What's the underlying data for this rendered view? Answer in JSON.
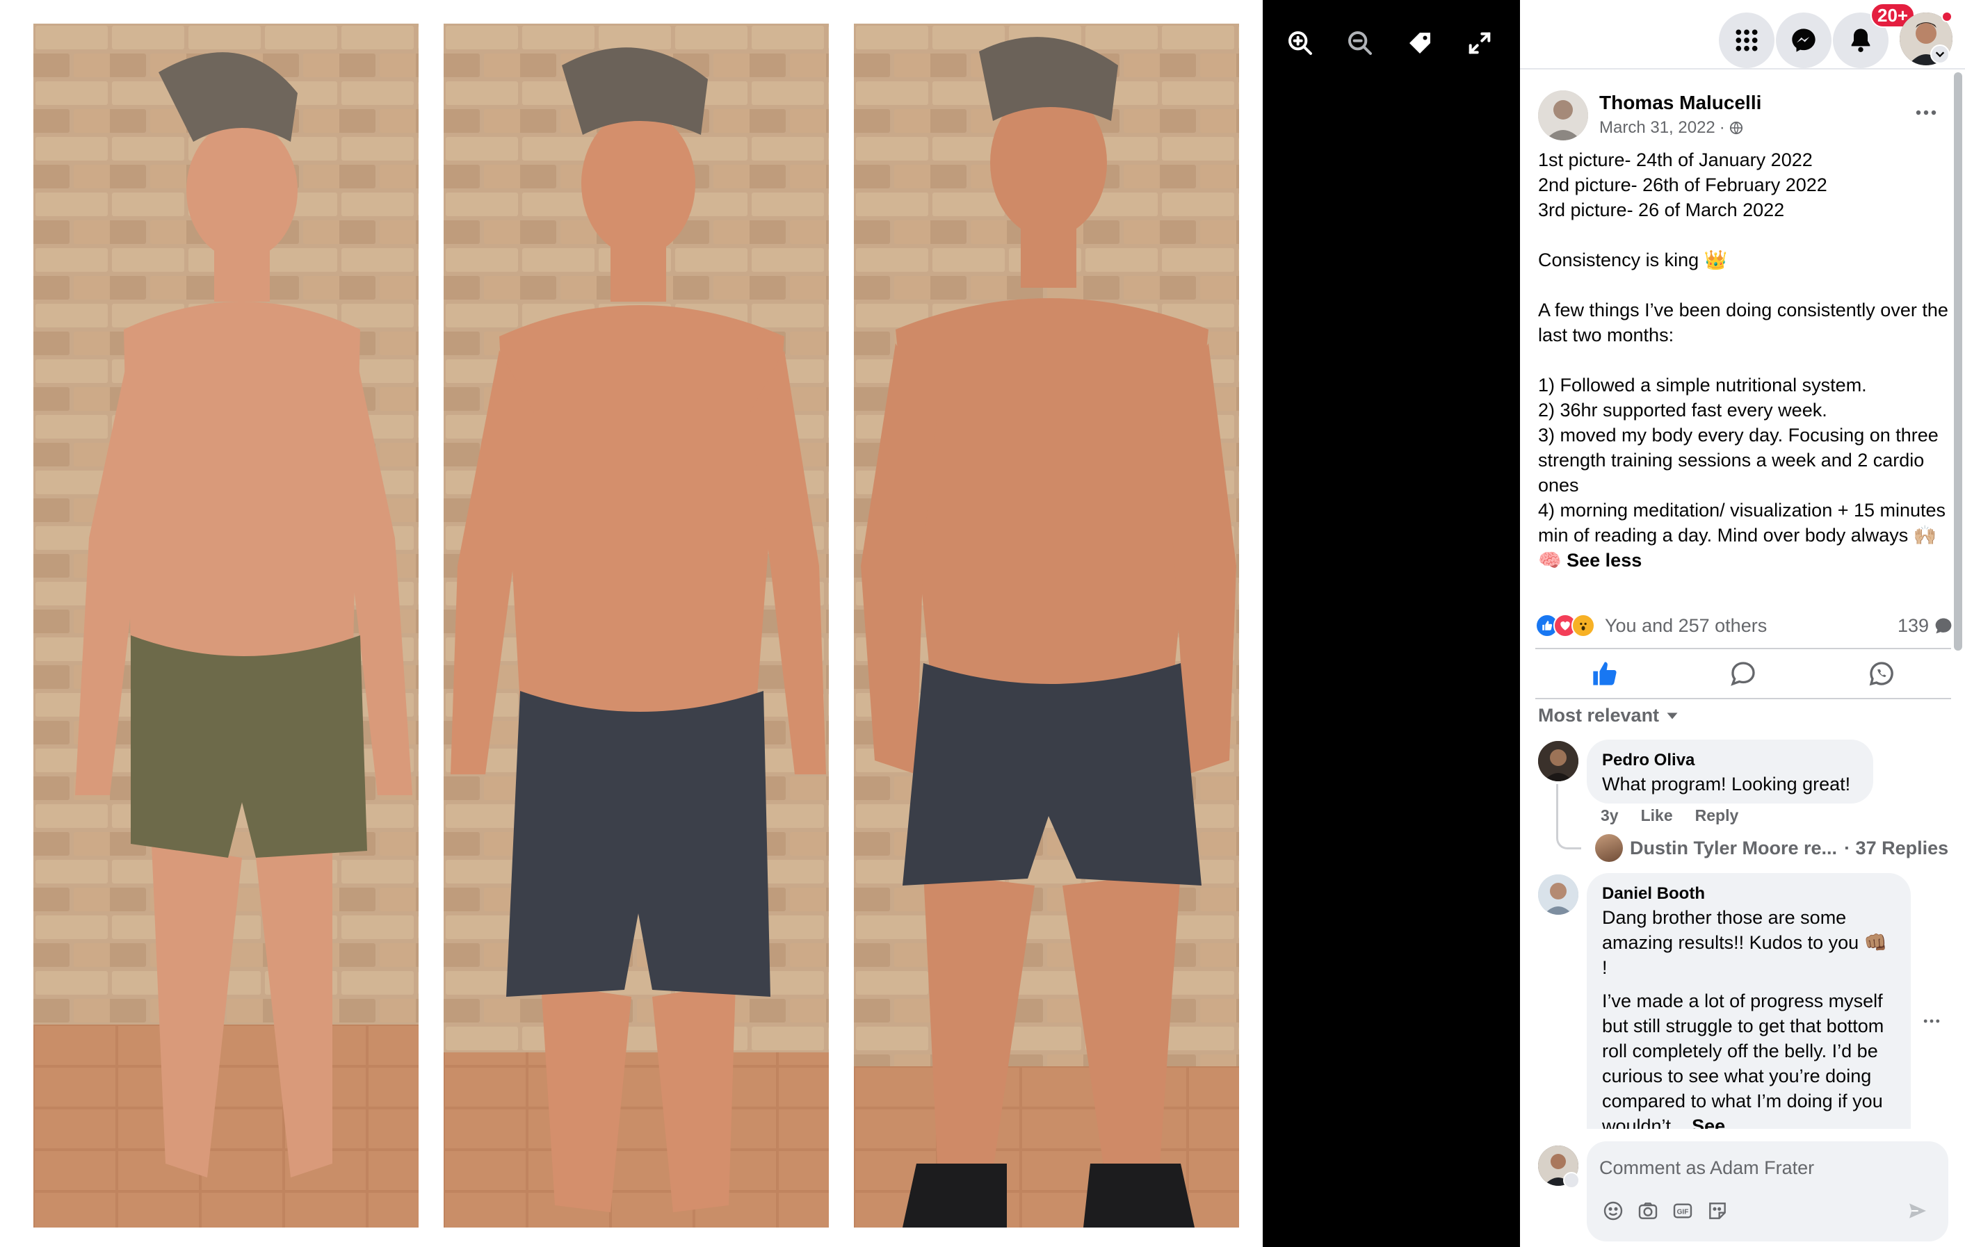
{
  "viewer": {
    "controls": [
      "zoom-in-icon",
      "zoom-out-icon",
      "tag-icon",
      "fullscreen-icon"
    ]
  },
  "topnav": {
    "notification_badge": "20+",
    "icons": [
      "menu-grid-icon",
      "messenger-icon",
      "bell-icon",
      "avatar"
    ]
  },
  "post": {
    "author": "Thomas Malucelli",
    "date": "March 31, 2022",
    "date_separator": "·",
    "body": {
      "line1": "1st picture- 24th of January 2022",
      "line2": "2nd picture- 26th of February 2022",
      "line3": "3rd picture- 26 of March 2022",
      "line4": "Consistency is king 👑",
      "line5": "A few things I’ve been doing consistently over the last two months:",
      "line6": "1) Followed a simple nutritional system.",
      "line7": "2) 36hr supported fast every week.",
      "line8": "3) moved my body every day. Focusing on three strength training sessions a week and 2 cardio ones",
      "line9": "4) morning meditation/ visualization + 15 minutes min of reading a day. Mind over body always 🙌🏼🧠",
      "see_less": "See less"
    },
    "reactions_text": "You and 257 others",
    "comment_count": "139",
    "sort_label": "Most relevant"
  },
  "comments": [
    {
      "author": "Pedro Oliva",
      "text": "What program! Looking great!",
      "age": "3y",
      "like": "Like",
      "reply": "Reply",
      "replies_text": "Dustin Tyler Moore re...",
      "replies_count": "· 37 Replies"
    },
    {
      "author": "Daniel Booth",
      "text1": "Dang brother those are some amazing results!! Kudos to you 👊🏽 !",
      "text2": "I’ve made a lot of progress myself but still struggle to get that bottom roll completely off the belly. I’d be curious to see what you’re doing compared to what I’m doing if you wouldn’t...",
      "see_more": "See"
    }
  ],
  "compose": {
    "placeholder": "Comment as Adam Frater"
  },
  "colors": {
    "facebook_blue": "#1877f2",
    "badge_red": "#e41e3f",
    "secondary_text": "#65676b",
    "bubble_bg": "#f0f2f5"
  }
}
